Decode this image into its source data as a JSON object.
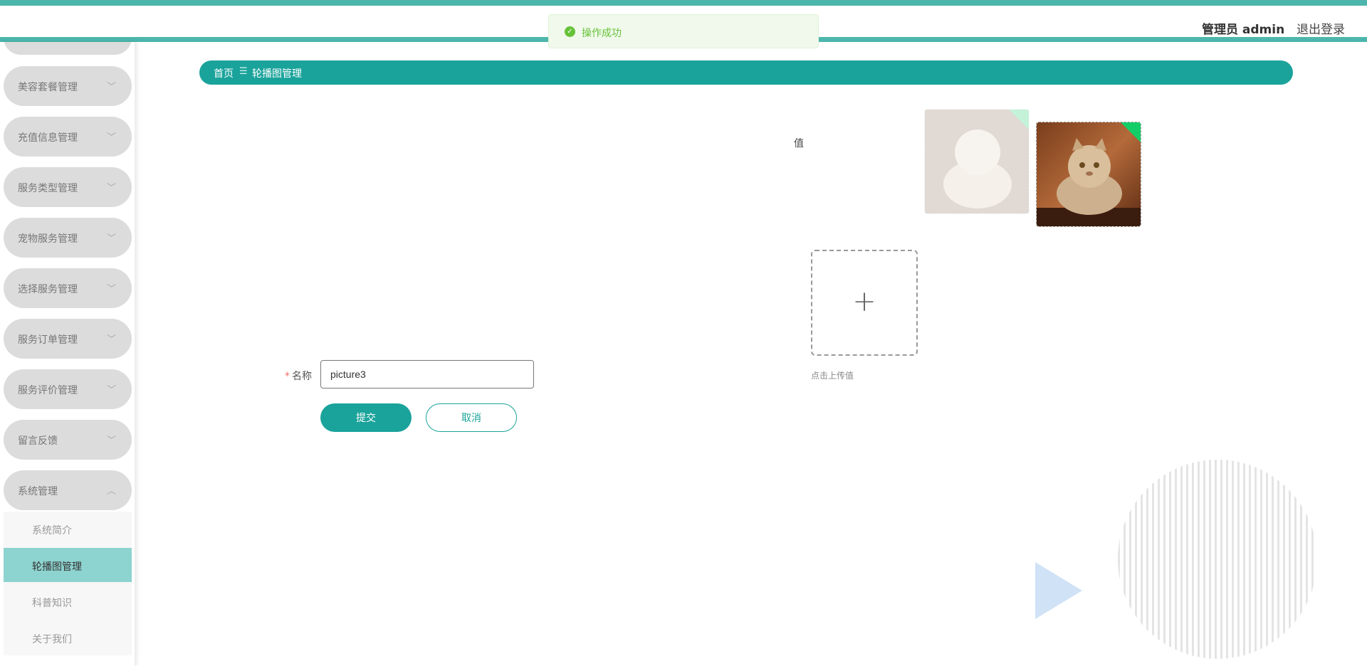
{
  "header": {
    "user_label": "管理员 admin",
    "logout_label": "退出登录"
  },
  "toast": {
    "message": "操作成功",
    "icon": "check-circle-icon",
    "color": "#67c23a"
  },
  "sidebar": {
    "items": [
      {
        "label": "美容套餐管理",
        "icon": "chevron-down-icon"
      },
      {
        "label": "充值信息管理",
        "icon": "chevron-down-icon"
      },
      {
        "label": "服务类型管理",
        "icon": "chevron-down-icon"
      },
      {
        "label": "宠物服务管理",
        "icon": "chevron-down-icon"
      },
      {
        "label": "选择服务管理",
        "icon": "chevron-down-icon"
      },
      {
        "label": "服务订单管理",
        "icon": "chevron-down-icon"
      },
      {
        "label": "服务评价管理",
        "icon": "chevron-down-icon"
      },
      {
        "label": "留言反馈",
        "icon": "chevron-down-icon"
      },
      {
        "label": "系统管理",
        "icon": "chevron-up-icon",
        "expanded": true
      }
    ],
    "subitems": [
      {
        "label": "系统简介"
      },
      {
        "label": "轮播图管理",
        "active": true
      },
      {
        "label": "科普知识"
      },
      {
        "label": "关于我们"
      }
    ]
  },
  "breadcrumb": {
    "home": "首页",
    "separator": "☰",
    "current": "轮播图管理"
  },
  "form": {
    "value_label": "值",
    "upload_hint": "点击上传值",
    "name_required_mark": "*",
    "name_label": "名称",
    "name_value": "picture3",
    "submit_label": "提交",
    "cancel_label": "取消"
  },
  "colors": {
    "accent": "#1aa39b",
    "topbar": "#4db6ac",
    "active_menu": "#8dd3cf",
    "success": "#13ce66"
  }
}
